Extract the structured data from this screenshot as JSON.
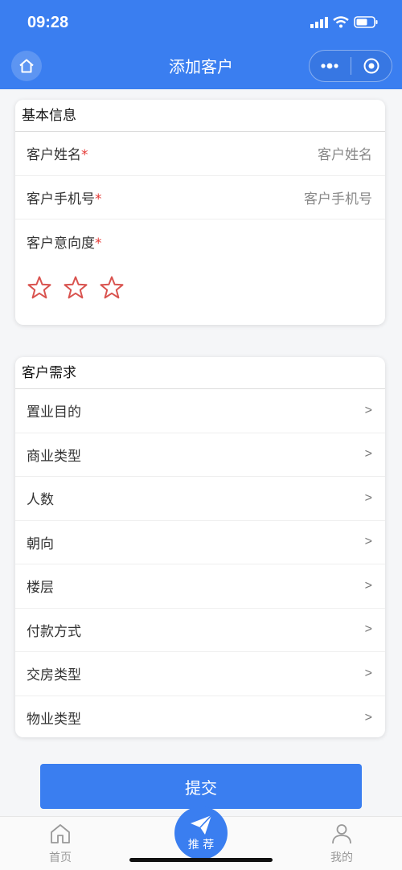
{
  "status": {
    "time": "09:28"
  },
  "nav": {
    "title": "添加客户"
  },
  "basic": {
    "heading": "基本信息",
    "name_label": "客户姓名",
    "name_placeholder": "客户姓名",
    "phone_label": "客户手机号",
    "phone_placeholder": "客户手机号",
    "intent_label": "客户意向度",
    "required_mark": "*",
    "stars_total": 3,
    "stars_filled": 0
  },
  "needs": {
    "heading": "客户需求",
    "arrow": ">",
    "items": [
      "置业目的",
      "商业类型",
      "人数",
      "朝向",
      "楼层",
      "付款方式",
      "交房类型",
      "物业类型"
    ]
  },
  "submit": {
    "label": "提交"
  },
  "tabbar": {
    "home": "首页",
    "recommend": "推 荐",
    "mine": "我的"
  },
  "colors": {
    "brand": "#3a7ef0",
    "required": "#e53935",
    "star": "#d9534f"
  }
}
